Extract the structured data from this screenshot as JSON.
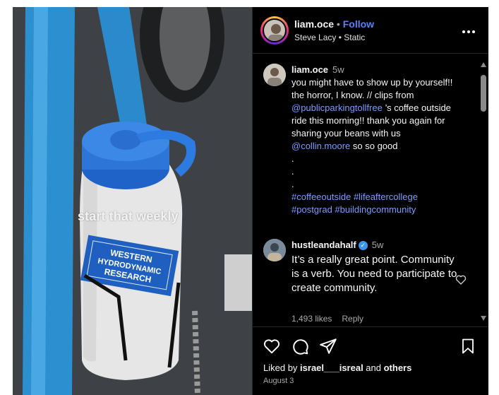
{
  "media": {
    "overlay_text": "start that weekly",
    "bottle_label": [
      "WESTERN",
      "HYDRODYNAMIC",
      "RESEARCH"
    ]
  },
  "header": {
    "username": "liam.oce",
    "separator": "•",
    "follow_label": "Follow",
    "audio": "Steve Lacy • Static",
    "more_icon": "more-horizontal-icon"
  },
  "caption": {
    "username": "liam.oce",
    "time": "5w",
    "text_before_mention1": "you might have to show up by yourself!! the horror, I know. // clips from ",
    "mention1": "@publicparkingtollfree",
    "text_after_mention1": " ’s coffee outside ride this morning!! thank you again for sharing your beans with us ",
    "mention2": "@collin.moore",
    "text_after_mention2": " so so good",
    "dots": [
      ".",
      ".",
      "."
    ],
    "hashtags_line1": "#coffeeoutside #lifeaftercollege",
    "hashtags_line2": "#postgrad #buildingcommunity"
  },
  "reply": {
    "username": "hustleandahalf",
    "time": "5w",
    "text": "It’s a really great point. Community is a verb. You need to participate to create community.",
    "likes": "1,493 likes",
    "reply_label": "Reply"
  },
  "actions": {
    "icons": [
      "heart-icon",
      "comment-icon",
      "share-icon",
      "bookmark-icon"
    ],
    "liked_by_prefix": "Liked by ",
    "liked_by_user": "israel___isreal",
    "liked_by_middle": " and ",
    "liked_by_others": "others",
    "date": "August 3"
  },
  "colors": {
    "background": "#000000",
    "link": "#7a9cff",
    "follow": "#5b82f0",
    "verified": "#3897f0",
    "muted": "#a8a8a8"
  }
}
